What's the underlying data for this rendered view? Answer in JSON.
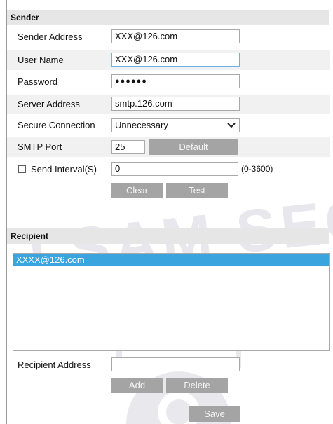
{
  "sender": {
    "title": "Sender",
    "sender_address_label": "Sender Address",
    "sender_address_value": "XXX@126.com",
    "user_name_label": "User Name",
    "user_name_value": "XXX@126.com",
    "password_label": "Password",
    "password_value": "●●●●●●",
    "server_address_label": "Server Address",
    "server_address_value": "smtp.126.com",
    "secure_connection_label": "Secure Connection",
    "secure_connection_value": "Unnecessary",
    "smtp_port_label": "SMTP Port",
    "smtp_port_value": "25",
    "default_button": "Default",
    "send_interval_label": "Send Interval(S)",
    "send_interval_value": "0",
    "send_interval_hint": "(0-3600)",
    "clear_button": "Clear",
    "test_button": "Test"
  },
  "recipient": {
    "title": "Recipient",
    "list_items": [
      "XXXX@126.com"
    ],
    "recipient_address_label": "Recipient Address",
    "recipient_address_value": "",
    "add_button": "Add",
    "delete_button": "Delete"
  },
  "save_button": "Save",
  "watermark_text": "LSAM SECU",
  "colors": {
    "button_bg": "#a4a4a4",
    "selection_bg": "#3aa4df",
    "section_header_bg": "#e6e6e6"
  }
}
